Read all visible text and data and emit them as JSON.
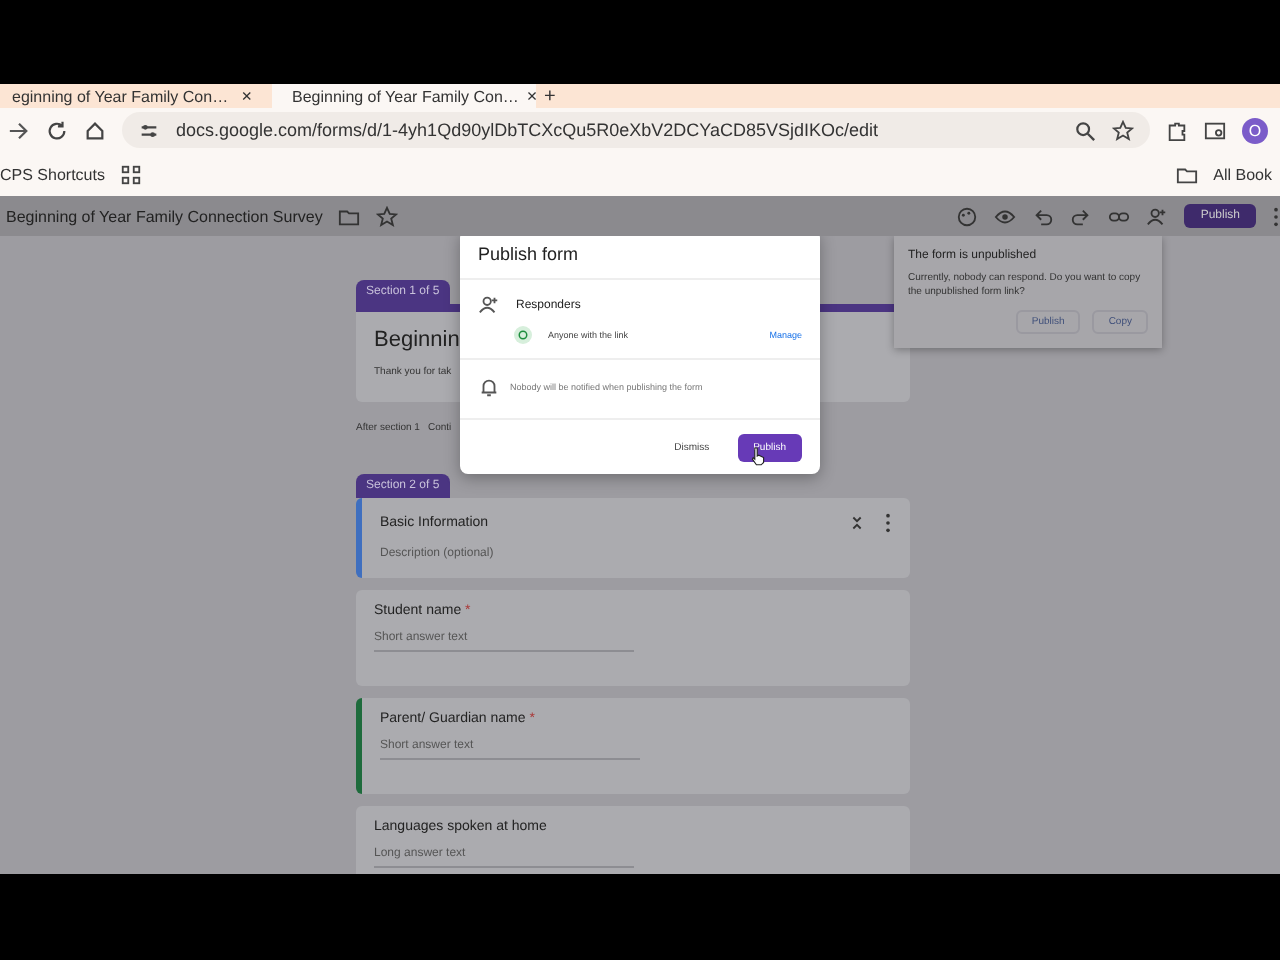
{
  "browser": {
    "tabs": [
      {
        "label": "eginning of Year Family Con…",
        "selected": false,
        "close": "×"
      },
      {
        "label": "Beginning of Year Family Con…",
        "selected": true,
        "close": "×"
      }
    ],
    "new_tab": "+",
    "url": "docs.google.com/forms/d/1-4yh1Qd90ylDbTCXcQu5R0eXbV2DCYaCD85VSjdIKOc/edit",
    "avatar": "O",
    "bookmarks": [
      {
        "label": "CPS Shortcuts"
      }
    ],
    "all_bookmarks": "All Book"
  },
  "form_header": {
    "title": "Beginning of Year Family Connection Survey",
    "publish": "Publish"
  },
  "sections": [
    {
      "badge": "Section 1 of 5",
      "cards": [
        {
          "kind": "title",
          "title": "Beginnin",
          "description": "Thank you for tak"
        }
      ],
      "after": [
        "After section 1",
        "Conti"
      ]
    },
    {
      "badge": "Section 2 of 5",
      "cards": [
        {
          "kind": "section",
          "title": "Basic Information",
          "description": "Description (optional)",
          "color": "#3f6fbf"
        },
        {
          "kind": "question",
          "title": "Student name",
          "required_mark": "*",
          "answer_hint": "Short answer text"
        },
        {
          "kind": "question",
          "title": "Parent/ Guardian name",
          "required_mark": "*",
          "answer_hint": "Short answer text",
          "color": "#1e6b3c"
        },
        {
          "kind": "question",
          "title": "Languages spoken at home",
          "answer_hint": "Long answer text"
        }
      ]
    }
  ],
  "dialog": {
    "title": "Publish form",
    "responders_label": "Responders",
    "access": "Anyone with the link",
    "manage": "Manage",
    "notice": "Nobody will be notified when publishing the form",
    "buttons": [
      {
        "label": "Dismiss",
        "kind": "text"
      },
      {
        "label": "Publish",
        "kind": "filled"
      }
    ]
  },
  "popup": {
    "title": "The form is unpublished",
    "body": "Currently, nobody can respond. Do you want to copy the unpublished form link?",
    "buttons": [
      "Publish",
      "Copy"
    ]
  }
}
